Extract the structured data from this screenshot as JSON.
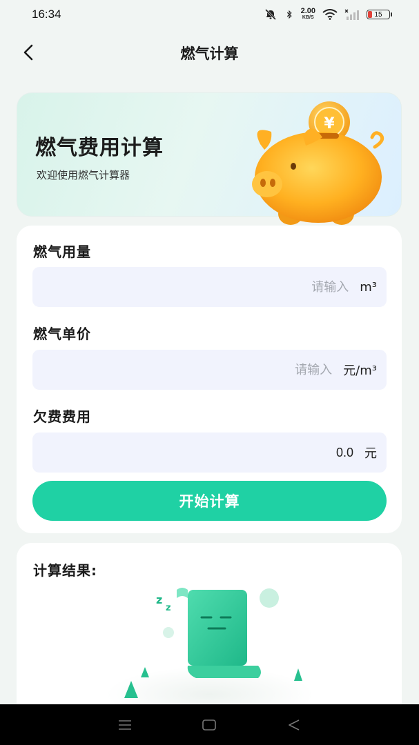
{
  "status": {
    "time": "16:34",
    "net_speed_value": "2.00",
    "net_speed_unit": "KB/S",
    "battery": "15"
  },
  "nav": {
    "title": "燃气计算"
  },
  "banner": {
    "title": "燃气费用计算",
    "subtitle": "欢迎使用燃气计算器"
  },
  "form": {
    "usage": {
      "label": "燃气用量",
      "placeholder": "请输入",
      "unit": "m³"
    },
    "price": {
      "label": "燃气单价",
      "placeholder": "请输入",
      "unit": "元/m³"
    },
    "arrears": {
      "label": "欠费费用",
      "value": "0.0",
      "unit": "元"
    },
    "calculate_label": "开始计算"
  },
  "result": {
    "title": "计算结果:"
  },
  "colors": {
    "accent": "#1fd1a4",
    "input_bg": "#f1f3fd",
    "page_bg": "#f1f5f3"
  },
  "icons": {
    "back": "chevron-left-icon",
    "mute": "bell-off-icon",
    "bluetooth": "bluetooth-icon",
    "wifi": "wifi-icon",
    "signal": "signal-icon",
    "battery": "battery-icon",
    "menu": "menu-icon",
    "home": "home-icon",
    "back_nav": "triangle-back-icon"
  }
}
